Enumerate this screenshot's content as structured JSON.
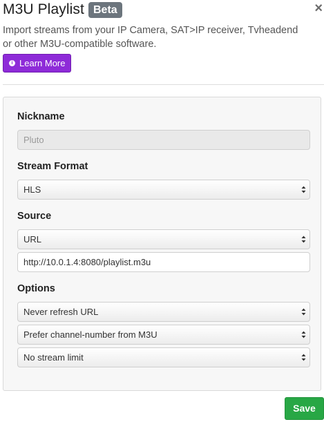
{
  "header": {
    "title": "M3U Playlist",
    "badge": "Beta",
    "close_glyph": "×"
  },
  "description": "Import streams from your IP Camera, SAT>IP receiver, Tvheadend or other M3U-compatible software.",
  "learn_more": {
    "icon": "info-circle-icon",
    "label": "Learn More",
    "color": "#8e2bd8"
  },
  "form": {
    "nickname": {
      "label": "Nickname",
      "placeholder": "Pluto",
      "value": ""
    },
    "stream_format": {
      "label": "Stream Format",
      "selected": "HLS"
    },
    "source": {
      "label": "Source",
      "selected": "URL",
      "url_value": "http://10.0.1.4:8080/playlist.m3u"
    },
    "options": {
      "label": "Options",
      "refresh": "Never refresh URL",
      "channel_number": "Prefer channel-number from M3U",
      "stream_limit": "No stream limit"
    }
  },
  "save_label": "Save",
  "colors": {
    "save": "#28a745",
    "badge": "#6c757d"
  }
}
